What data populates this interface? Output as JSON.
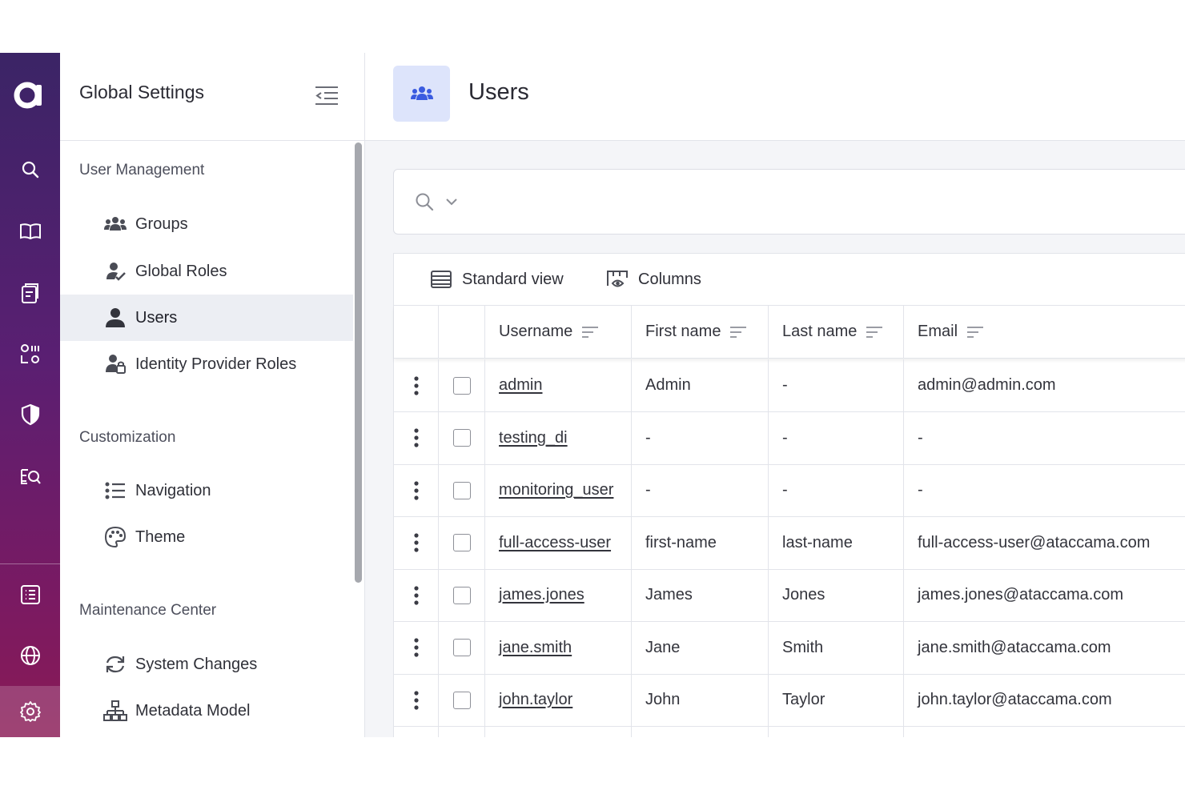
{
  "rail": {
    "items": [
      {
        "name": "search-icon"
      },
      {
        "name": "book-icon"
      },
      {
        "name": "clipboard-icon"
      },
      {
        "name": "data-quality-icon"
      },
      {
        "name": "shield-icon"
      },
      {
        "name": "search-list-icon"
      },
      {
        "name": "task-list-icon"
      },
      {
        "name": "globe-icon"
      },
      {
        "name": "gear-icon"
      }
    ],
    "active": "gear-icon"
  },
  "panel": {
    "title": "Global Settings",
    "sections": [
      {
        "title": "User Management",
        "items": [
          {
            "label": "Groups",
            "icon": "users-group-icon"
          },
          {
            "label": "Global Roles",
            "icon": "user-check-icon"
          },
          {
            "label": "Users",
            "icon": "user-icon",
            "selected": true
          },
          {
            "label": "Identity Provider Roles",
            "icon": "user-lock-icon"
          }
        ]
      },
      {
        "title": "Customization",
        "items": [
          {
            "label": "Navigation",
            "icon": "list-icon"
          },
          {
            "label": "Theme",
            "icon": "palette-icon"
          }
        ]
      },
      {
        "title": "Maintenance Center",
        "items": [
          {
            "label": "System Changes",
            "icon": "sync-icon"
          },
          {
            "label": "Metadata Model",
            "icon": "sitemap-icon"
          }
        ]
      }
    ]
  },
  "main": {
    "title": "Users",
    "toolbar": {
      "standard_view": "Standard view",
      "columns": "Columns"
    },
    "columns": [
      "Username",
      "First name",
      "Last name",
      "Email"
    ],
    "rows": [
      {
        "username": "admin",
        "first": "Admin",
        "last": "-",
        "email": "admin@admin.com"
      },
      {
        "username": "testing_di",
        "first": "-",
        "last": "-",
        "email": "-"
      },
      {
        "username": "monitoring_user",
        "first": "-",
        "last": "-",
        "email": "-"
      },
      {
        "username": "full-access-user",
        "first": "first-name",
        "last": "last-name",
        "email": "full-access-user@ataccama.com"
      },
      {
        "username": "james.jones",
        "first": "James",
        "last": "Jones",
        "email": "james.jones@ataccama.com"
      },
      {
        "username": "jane.smith",
        "first": "Jane",
        "last": "Smith",
        "email": "jane.smith@ataccama.com"
      },
      {
        "username": "john.taylor",
        "first": "John",
        "last": "Taylor",
        "email": "john.taylor@ataccama.com"
      }
    ]
  },
  "colors": {
    "accent": "#3a5be0",
    "rail_top": "#3b2466",
    "rail_bottom": "#8a1a55",
    "selected_bg": "#eceef3"
  }
}
